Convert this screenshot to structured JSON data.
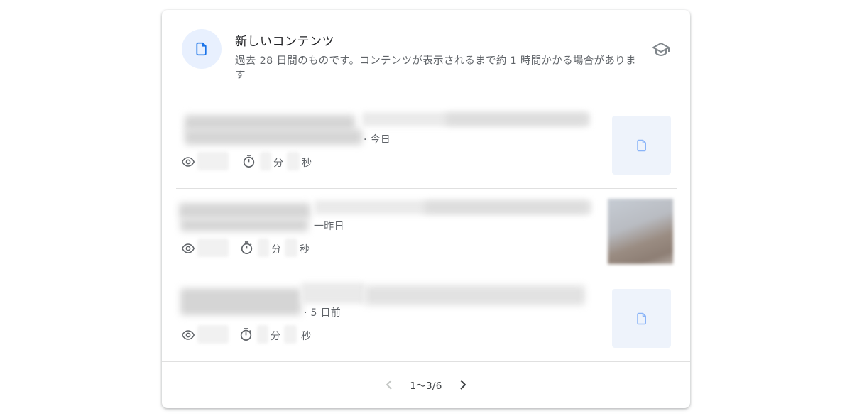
{
  "card": {
    "title": "新しいコンテンツ",
    "subtitle": "過去 28 日間のものです。コンテンツが表示されるまで約 1 時間かかる場合があります"
  },
  "items": [
    {
      "date": "· 今日",
      "minutes_unit": "分",
      "seconds_unit": "秒",
      "thumbnail": "document-icon"
    },
    {
      "date": "一昨日",
      "minutes_unit": "分",
      "seconds_unit": "秒",
      "thumbnail": "image"
    },
    {
      "date": "· 5 日前",
      "minutes_unit": "分",
      "seconds_unit": "秒",
      "thumbnail": "document-icon"
    }
  ],
  "pagination": {
    "label": "1〜3/6"
  },
  "colors": {
    "accent": "#1a73e8",
    "icon_bg": "#e8f0fe",
    "doc_thumb_bg": "#eef3fb",
    "muted_text": "#5f6368"
  }
}
